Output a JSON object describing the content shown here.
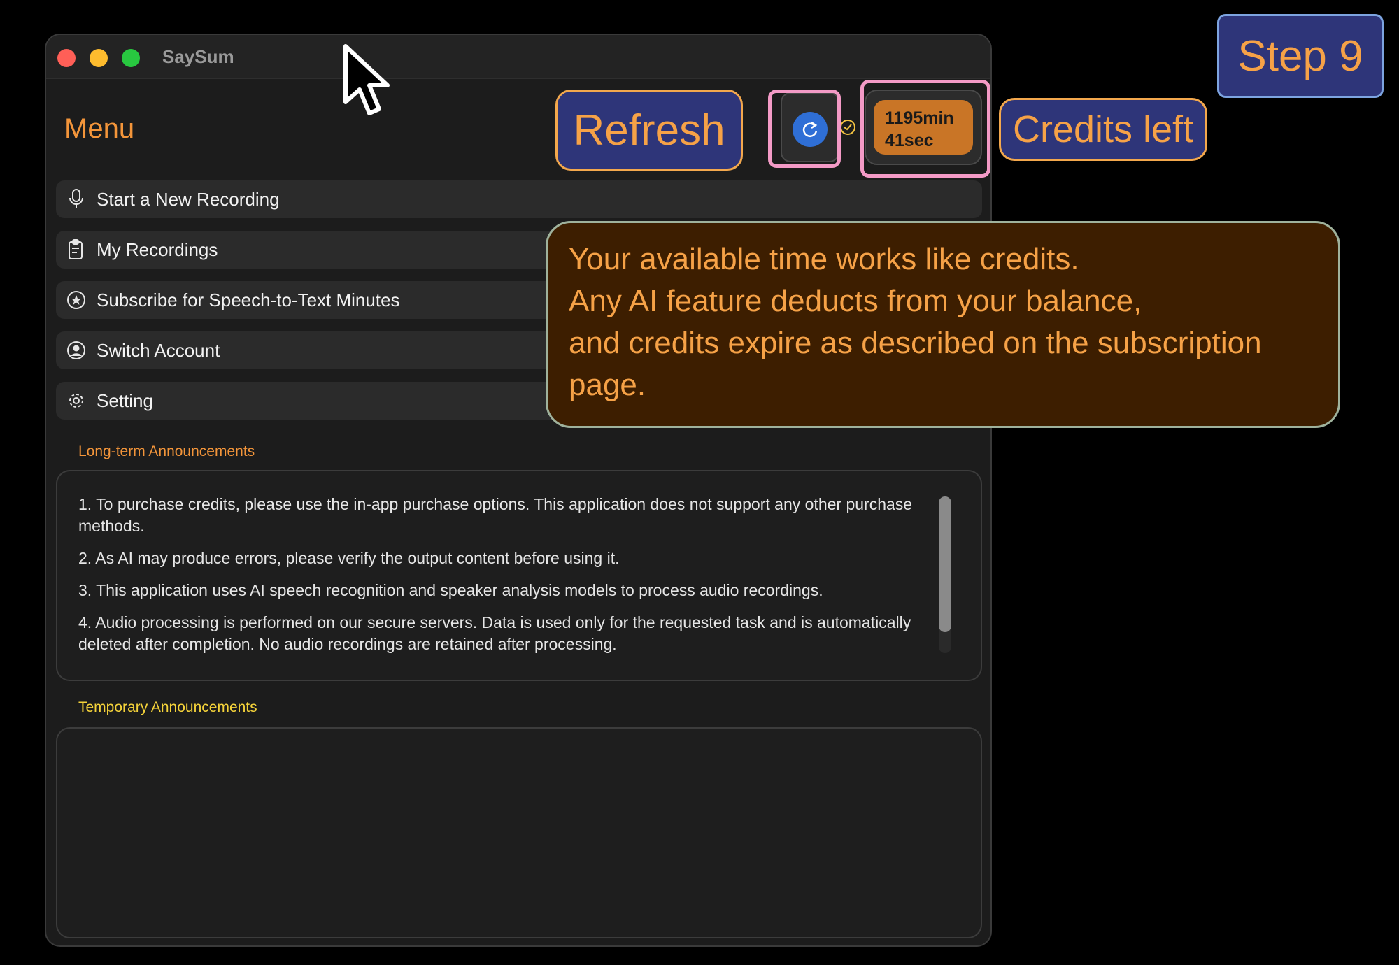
{
  "window": {
    "title": "SaySum"
  },
  "menu": {
    "title": "Menu",
    "items": [
      {
        "label": "Start a New Recording",
        "icon": "microphone-icon"
      },
      {
        "label": "My Recordings",
        "icon": "clipboard-icon"
      },
      {
        "label": "Subscribe for Speech-to-Text Minutes",
        "icon": "star-circle-icon"
      },
      {
        "label": "Switch Account",
        "icon": "person-circle-icon"
      },
      {
        "label": "Setting",
        "icon": "gear-icon"
      }
    ]
  },
  "credits": {
    "minutes": "1195min",
    "seconds": "41sec"
  },
  "announcements": {
    "long_term_label": "Long-term Announcements",
    "long_term_items": [
      "1. To purchase credits, please use the in-app purchase options. This application does not support any other purchase methods.",
      "2. As AI may produce errors, please verify the output content before using it.",
      "3. This application uses AI speech recognition and speaker analysis models to process audio recordings.",
      "4. Audio processing is performed on our secure servers. Data is used only for the requested task and is automatically deleted after completion. No audio recordings are retained after processing."
    ],
    "temporary_label": "Temporary Announcements"
  },
  "annotations": {
    "step": "Step 9",
    "refresh_callout": "Refresh",
    "credits_callout": "Credits left",
    "tooltip_lines": [
      "Your available time works like credits.",
      "Any AI feature deducts from your balance,",
      "and credits expire as described on the subscription",
      "page."
    ]
  },
  "colors": {
    "accent_orange": "#f3953a",
    "temporary_yellow": "#f5d33a",
    "refresh_blue": "#2f6fd6",
    "credits_pill": "#c97526",
    "highlight_pink": "#f39ac6",
    "callout_bg": "#2e3579",
    "tooltip_bg": "#3d1e00"
  }
}
